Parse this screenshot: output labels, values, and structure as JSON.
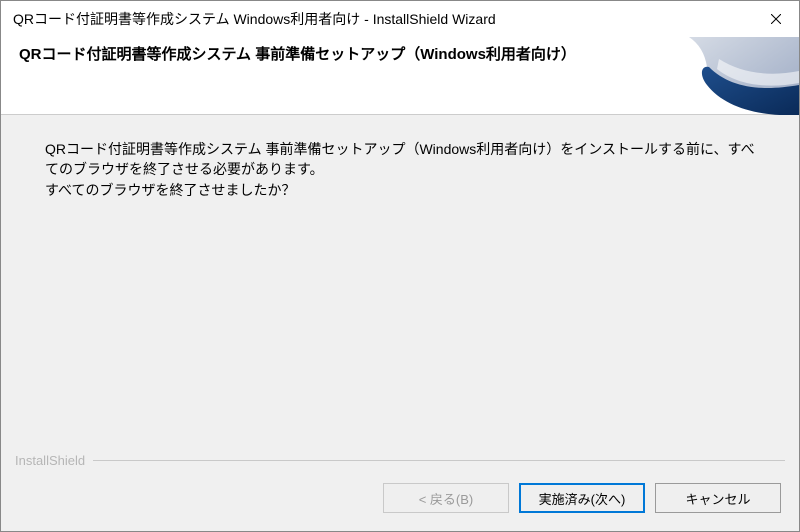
{
  "window": {
    "title": "QRコード付証明書等作成システム Windows利用者向け - InstallShield Wizard"
  },
  "header": {
    "title": "QRコード付証明書等作成システム 事前準備セットアップ（Windows利用者向け）"
  },
  "content": {
    "line1": "QRコード付証明書等作成システム 事前準備セットアップ（Windows利用者向け）をインストールする前に、すべてのブラウザを終了させる必要があります。",
    "line2": "すべてのブラウザを終了させましたか？"
  },
  "footer": {
    "brand": "InstallShield"
  },
  "buttons": {
    "back": "< 戻る(B)",
    "next": "実施済み(次へ)",
    "cancel": "キャンセル"
  }
}
